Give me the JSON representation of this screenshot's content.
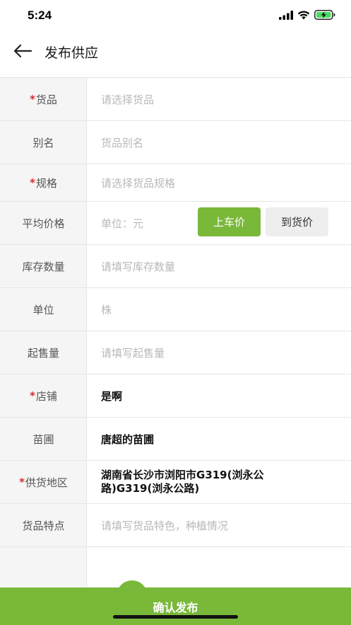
{
  "status_bar": {
    "time": "5:24"
  },
  "header": {
    "title": "发布供应",
    "back_icon": "back-arrow-icon"
  },
  "form": {
    "rows": [
      {
        "label": "货品",
        "required": true,
        "placeholder": "请选择货品",
        "value": ""
      },
      {
        "label": "别名",
        "required": false,
        "placeholder": "货品别名",
        "value": ""
      },
      {
        "label": "规格",
        "required": true,
        "placeholder": "请选择货品规格",
        "value": ""
      },
      {
        "label": "平均价格",
        "required": false,
        "placeholder": "单位：元",
        "value": ""
      },
      {
        "label": "库存数量",
        "required": false,
        "placeholder": "请填写库存数量",
        "value": ""
      },
      {
        "label": "单位",
        "required": false,
        "placeholder": "株",
        "value": ""
      },
      {
        "label": "起售量",
        "required": false,
        "placeholder": "请填写起售量",
        "value": ""
      },
      {
        "label": "店铺",
        "required": true,
        "placeholder": "",
        "value": "是啊"
      },
      {
        "label": "苗圃",
        "required": false,
        "placeholder": "",
        "value": "唐超的苗圃"
      },
      {
        "label": "供货地区",
        "required": true,
        "placeholder": "",
        "value": "湖南省长沙市浏阳市G319(浏永公路)G319(浏永公路)"
      },
      {
        "label": "货品特点",
        "required": false,
        "placeholder": "请填写货品特色，种植情况",
        "value": ""
      }
    ],
    "required_mark": "*",
    "price_buttons": {
      "shangche": "上车价",
      "daohuo": "到货价",
      "selected": "shangche"
    }
  },
  "footer": {
    "confirm_label": "确认发布"
  },
  "colors": {
    "accent": "#7ab83a",
    "required": "#d0312d",
    "label_bg": "#f5f5f5"
  }
}
